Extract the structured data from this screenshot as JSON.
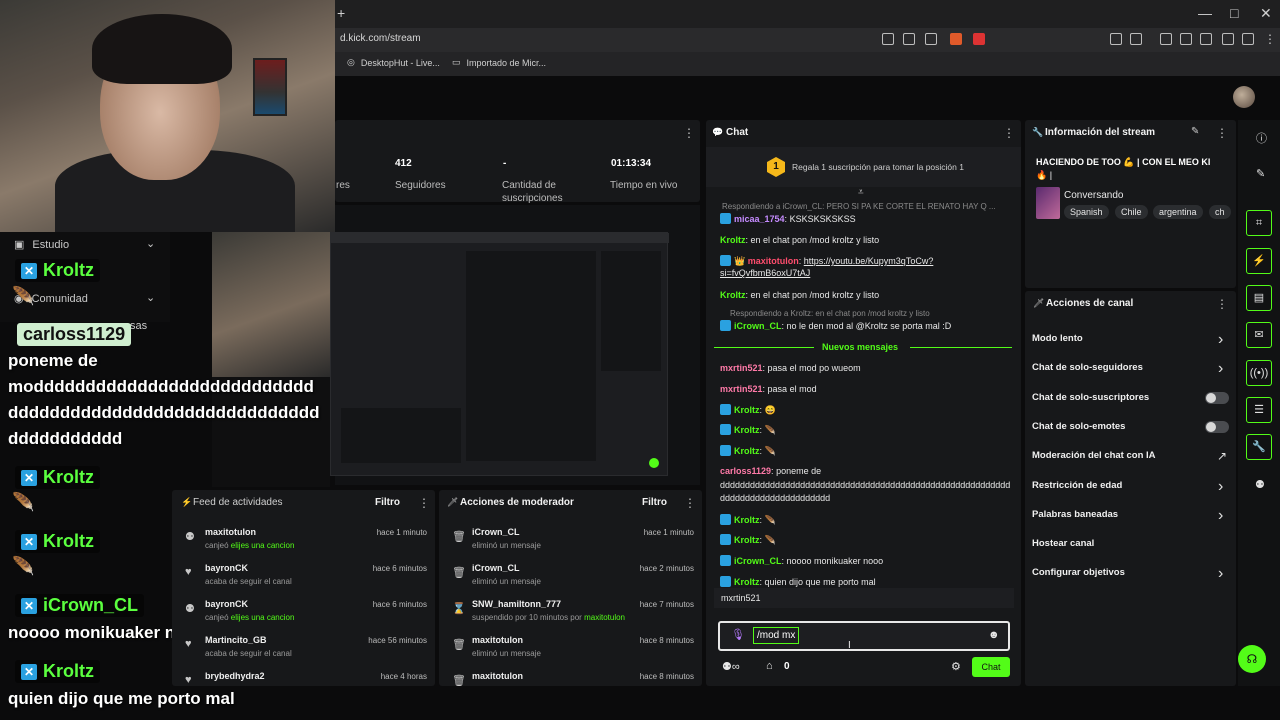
{
  "browser": {
    "url": "d.kick.com/stream",
    "bookmarks": [
      "DesktopHut - Live...",
      "Importado de Micr..."
    ],
    "new_tab": "+"
  },
  "stats": [
    {
      "value": "",
      "label": "res"
    },
    {
      "value": "412",
      "label": "Seguidores"
    },
    {
      "value": "-",
      "label": "Cantidad de suscripciones"
    },
    {
      "value": "01:13:34",
      "label": "Tiempo en vivo"
    }
  ],
  "overlay": {
    "side_menu": [
      "Estudio",
      "Comunidad"
    ],
    "partial_menu_text": "sas",
    "messages": [
      {
        "user": "Kroltz",
        "text": ""
      },
      {
        "user": "carloss1129",
        "text": "poneme de moddddddddddddddddddddddddddddddddddddddddddddddddddddddddddddddddddddddd"
      },
      {
        "user": "Kroltz",
        "text": ""
      },
      {
        "user": "Kroltz",
        "text": ""
      },
      {
        "user": "iCrown_CL",
        "text": "noooo monikuaker nooo"
      },
      {
        "user": "Kroltz",
        "text": "quien dijo que me porto mal"
      }
    ],
    "line2": "dddddddddddddddddddddddddddddd",
    "line3": "ddddddddddd"
  },
  "feed": {
    "title": "Feed de actividades",
    "filter": "Filtro",
    "items": [
      {
        "user": "maxitotulon",
        "sub_prefix": "canjeó ",
        "sub_green": "elijes una cancion",
        "time": "hace 1 minuto",
        "icon": "gift-icon"
      },
      {
        "user": "bayronCK",
        "sub_prefix": "acaba de seguir el canal",
        "sub_green": "",
        "time": "hace 6 minutos",
        "icon": "heart-icon"
      },
      {
        "user": "bayronCK",
        "sub_prefix": "canjeó ",
        "sub_green": "elijes una cancion",
        "time": "hace 6 minutos",
        "icon": "gift-icon"
      },
      {
        "user": "Martincito_GB",
        "sub_prefix": "acaba de seguir el canal",
        "sub_green": "",
        "time": "hace 56 minutos",
        "icon": "heart-icon"
      },
      {
        "user": "brybedhydra2",
        "sub_prefix": "",
        "sub_green": "",
        "time": "hace 4 horas",
        "icon": "heart-icon"
      }
    ]
  },
  "mod_actions": {
    "title": "Acciones de moderador",
    "filter": "Filtro",
    "items": [
      {
        "user": "iCrown_CL",
        "sub": "eliminó un mensaje",
        "sub_green": "",
        "time": "hace 1 minuto",
        "icon": "trash-icon"
      },
      {
        "user": "iCrown_CL",
        "sub": "eliminó un mensaje",
        "sub_green": "",
        "time": "hace 2 minutos",
        "icon": "trash-icon"
      },
      {
        "user": "SNW_hamiltonn_777",
        "sub": "suspendido por 10 minutos por ",
        "sub_green": "maxitotulon",
        "time": "hace 7 minutos",
        "icon": "hourglass-icon"
      },
      {
        "user": "maxitotulon",
        "sub": "eliminó un mensaje",
        "sub_green": "",
        "time": "hace 8 minutos",
        "icon": "trash-icon"
      },
      {
        "user": "maxitotulon",
        "sub": "",
        "sub_green": "",
        "time": "hace 8 minutos",
        "icon": "trash-icon"
      }
    ]
  },
  "chat": {
    "title": "Chat",
    "sub_banner": "Regala 1 suscripción para tomar la posición 1",
    "sub_rank": "1",
    "new_messages": "Nuevos mensajes",
    "input_value": "/mod mx",
    "send": "Chat",
    "points": "0",
    "suggestion": "mxrtin521",
    "lines": [
      {
        "reply": "Respondiendo a iCrown_CL: PERO SI PA KE CORTE EL RENATO HAY Q ..."
      },
      {
        "user": "micaa_1754",
        "cls": "u-purple",
        "text": "KSKSKSKSKSS",
        "badge": true
      },
      {
        "user": "Kroltz",
        "cls": "u-green",
        "text": "en el chat pon /mod kroltz y listo",
        "badge": false
      },
      {
        "user": "maxitotulon",
        "cls": "u-red",
        "text": "https://youtu.be/Kupym3qToCw?",
        "text2": "si=fvQvfbmB6oxU7tAJ",
        "badge": true
      },
      {
        "user": "Kroltz",
        "cls": "u-green",
        "text": "en el chat pon /mod kroltz y listo",
        "badge": false
      },
      {
        "reply": "Respondiendo a Kroltz: en el chat pon /mod kroltz y listo"
      },
      {
        "user": "iCrown_CL",
        "cls": "u-green",
        "text": "no le den mod al @Kroltz se porta mal :D",
        "badge": true
      }
    ],
    "after": [
      {
        "user": "mxrtin521",
        "cls": "u-pink",
        "text": "pasa el mod po wueom"
      },
      {
        "user": "mxrtin521",
        "cls": "u-pink",
        "text": "pasa el mod"
      },
      {
        "user": "Kroltz",
        "cls": "u-green",
        "text": "😄",
        "badge": true
      },
      {
        "user": "Kroltz",
        "cls": "u-green",
        "text": "🪶",
        "badge": true
      },
      {
        "user": "Kroltz",
        "cls": "u-green",
        "text": "🪶",
        "badge": true
      },
      {
        "user": "carloss1129",
        "cls": "u-pink",
        "text": "poneme de",
        "text2": "dddddddddddddddddddddddddddddddddddddddddddddddddddddddddd",
        "text3": "dddddddddddddddddddddd"
      },
      {
        "user": "Kroltz",
        "cls": "u-green",
        "text": "🪶",
        "badge": true
      },
      {
        "user": "Kroltz",
        "cls": "u-green",
        "text": "🪶",
        "badge": true
      },
      {
        "user": "iCrown_CL",
        "cls": "u-green",
        "text": "noooo monikuaker nooo",
        "badge": true
      },
      {
        "user": "Kroltz",
        "cls": "u-green",
        "text": "quien dijo que me porto mal",
        "badge": true
      }
    ]
  },
  "stream_info": {
    "title": "Información del stream",
    "stream_title": "HACIENDO DE TOO 💪 | CON EL MEO KI",
    "stream_title2": "🔥 |",
    "category": "Conversando",
    "tags": [
      "Spanish",
      "Chile",
      "argentina",
      "ch"
    ]
  },
  "channel_actions": {
    "title": "Acciones de canal",
    "items": [
      {
        "label": "Modo lento",
        "type": "chevron"
      },
      {
        "label": "Chat de solo-seguidores",
        "type": "chevron"
      },
      {
        "label": "Chat de solo-suscriptores",
        "type": "toggle"
      },
      {
        "label": "Chat de solo-emotes",
        "type": "toggle"
      },
      {
        "label": "Moderación del chat con IA",
        "type": "external"
      },
      {
        "label": "Restricción de edad",
        "type": "chevron"
      },
      {
        "label": "Palabras baneadas",
        "type": "chevron"
      },
      {
        "label": "Hostear canal",
        "type": "none"
      },
      {
        "label": "Configurar objetivos",
        "type": "chevron"
      }
    ]
  },
  "colors": {
    "accent": "#53fc18",
    "panel": "#17181a",
    "bg": "#0b0b0c"
  }
}
